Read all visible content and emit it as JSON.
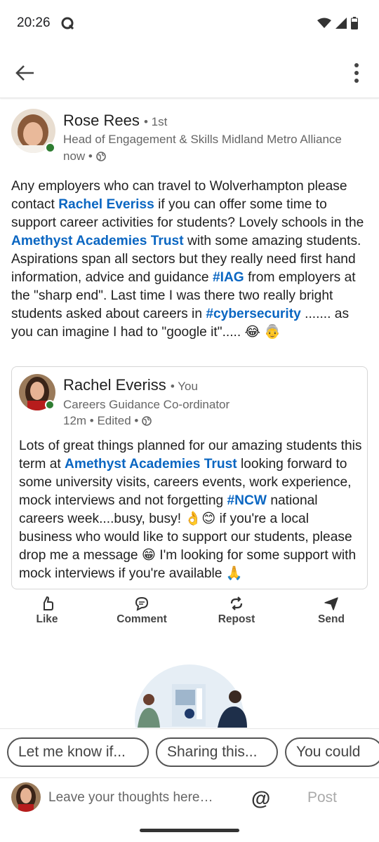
{
  "status": {
    "time": "20:26"
  },
  "post": {
    "author": {
      "name": "Rose Rees",
      "degree": "• 1st",
      "headline": "Head of Engagement & Skills Midland Metro Alliance",
      "time": "now •"
    },
    "body": [
      {
        "t": "Any employers who can travel to Wolverhampton please contact "
      },
      {
        "t": "Rachel Everiss",
        "link": true
      },
      {
        "t": " if you can offer some time to support career activities for students? Lovely schools in the "
      },
      {
        "t": "Amethyst Academies Trust",
        "link": true
      },
      {
        "t": " with some amazing students. Aspirations span all sectors but they really need first hand information, advice and guidance "
      },
      {
        "t": "#IAG",
        "link": true
      },
      {
        "t": " from employers at the \"sharp end\". Last time I was there two really bright students asked about careers in "
      },
      {
        "t": "#cybersecurity",
        "link": true
      },
      {
        "t": " ....... as you can imagine I had to \"google it\"..... 😂 👵"
      }
    ],
    "reposted": {
      "name": "Rachel Everiss",
      "you": "• You",
      "headline": "Careers Guidance Co-ordinator",
      "time": "12m • Edited •",
      "body": [
        {
          "t": "Lots of great things planned for our amazing students this term at "
        },
        {
          "t": "Amethyst Academies Trust",
          "link": true
        },
        {
          "t": " looking forward to some university visits, careers events, work experience, mock interviews and not forgetting "
        },
        {
          "t": "#NCW",
          "link": true
        },
        {
          "t": " national careers week....busy, busy! 👌😊 if you're a local business who would like to support our students, please drop me a message 😁 I'm looking for some support with mock interviews if you're available 🙏"
        }
      ]
    }
  },
  "actions": {
    "like": "Like",
    "comment": "Comment",
    "repost": "Repost",
    "send": "Send"
  },
  "suggestions": [
    "Let me know if...",
    "Sharing this...",
    "You could"
  ],
  "comment_bar": {
    "placeholder": "Leave your thoughts here…",
    "mention": "@",
    "post": "Post"
  },
  "colors": {
    "link": "#0a66c2",
    "online": "#2e7d32",
    "text": "#1f1f1f",
    "muted": "#666666"
  }
}
